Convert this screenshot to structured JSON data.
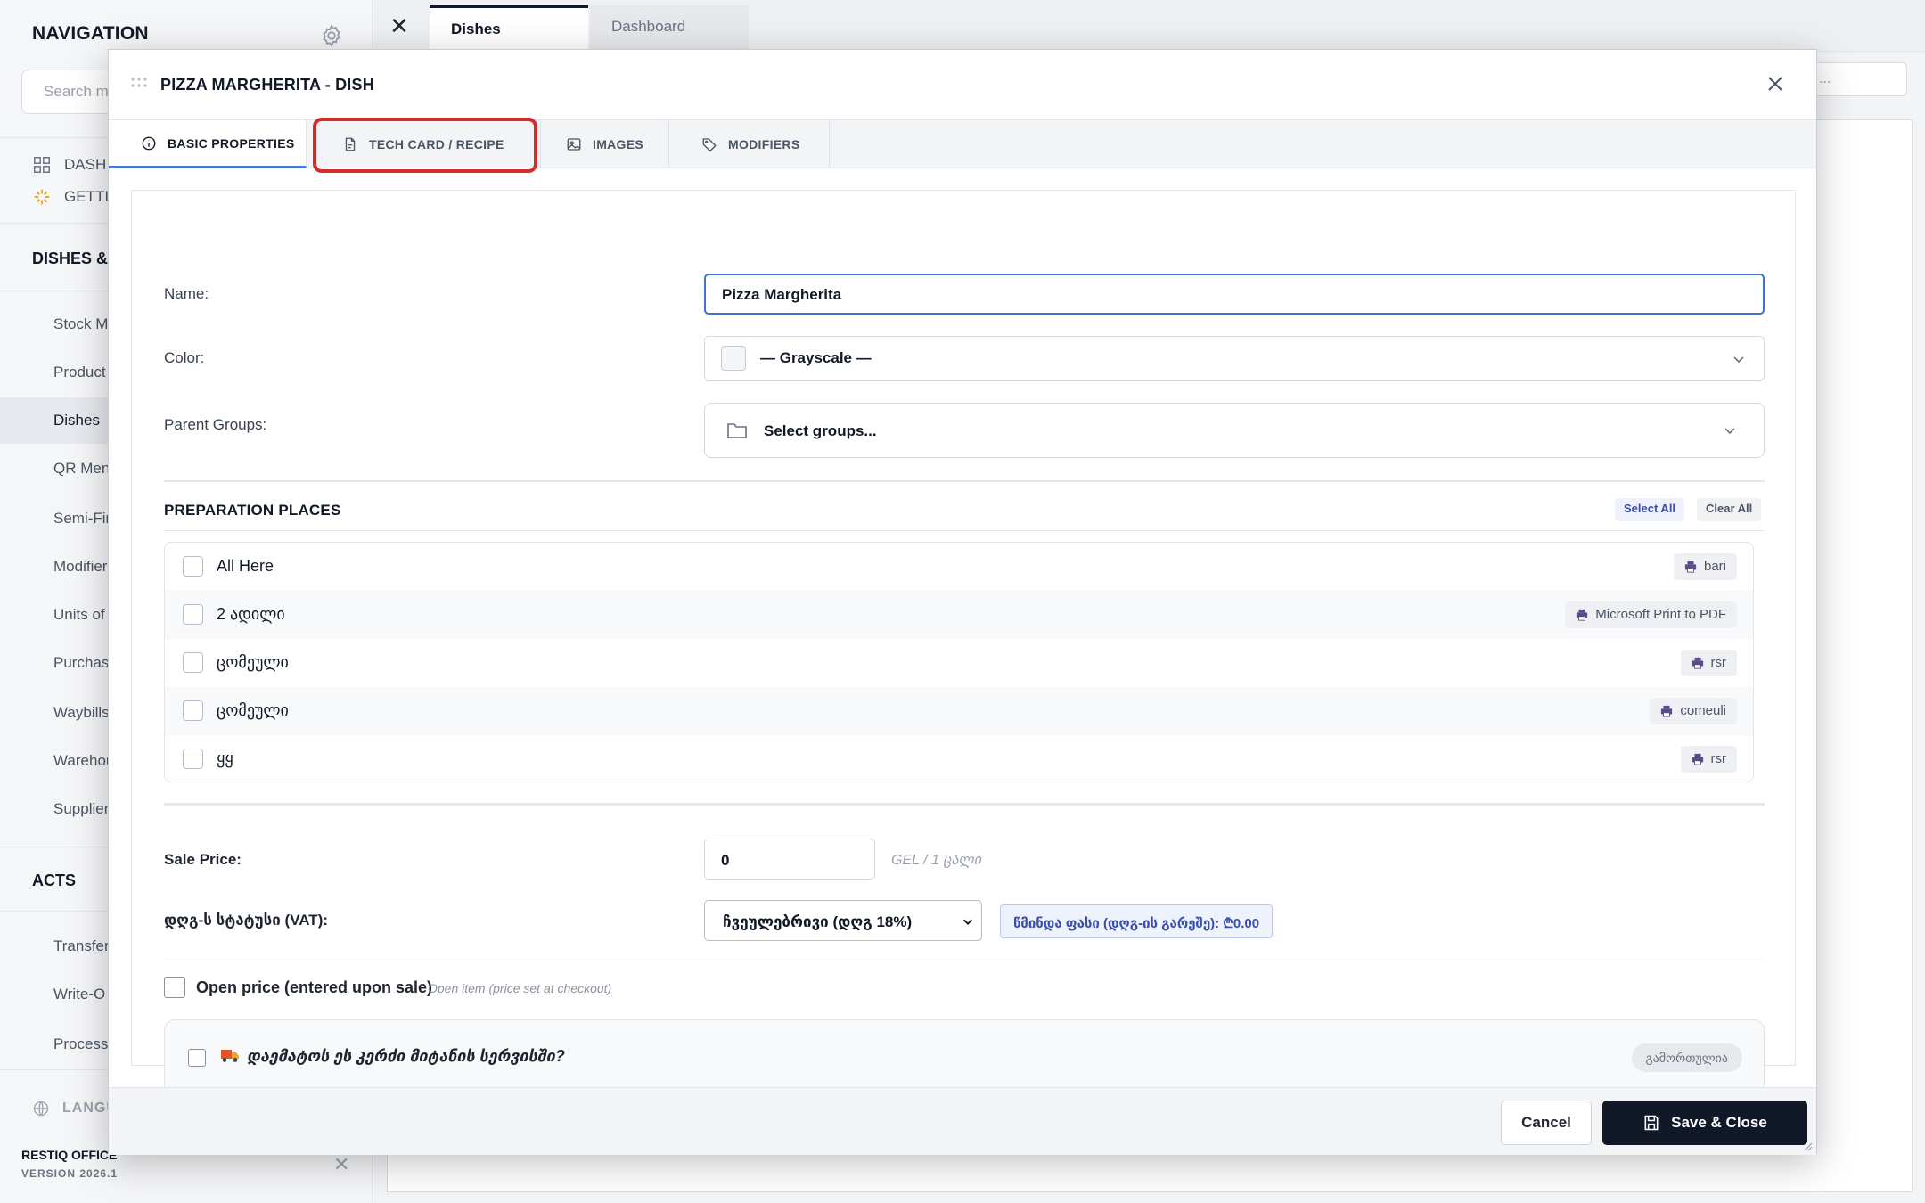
{
  "sidebar": {
    "title": "NAVIGATION",
    "search_placeholder": "Search m",
    "top_items": [
      {
        "label": "DASH",
        "icon": "grid-icon"
      },
      {
        "label": "GETTI",
        "icon": "sparkle-icon"
      }
    ],
    "sections": [
      {
        "title": "DISHES &",
        "items": [
          "Stock M",
          "Product",
          "Dishes",
          "QR Men",
          "Semi-Fir",
          "Modifier",
          "Units of",
          "Purchas",
          "Waybills",
          "Warehou",
          "Supplier"
        ]
      },
      {
        "title": "ACTS",
        "items": [
          "Transfer",
          "Write-O",
          "Processi"
        ]
      }
    ],
    "active_item": "Dishes",
    "language_label": "LANGU",
    "brand": "RESTIQ OFFICE",
    "version": "VERSION 2026.1"
  },
  "app_tabs": [
    {
      "label": "Dishes",
      "active": true
    },
    {
      "label": "Dashboard",
      "active": false
    }
  ],
  "background_search_placeholder": "...",
  "modal": {
    "title": "PIZZA MARGHERITA - DISH",
    "tabs": [
      {
        "label": "BASIC PROPERTIES",
        "icon": "info-icon",
        "active": true
      },
      {
        "label": "TECH CARD / RECIPE",
        "icon": "document-icon",
        "active": false
      },
      {
        "label": "IMAGES",
        "icon": "image-icon",
        "active": false
      },
      {
        "label": "MODIFIERS",
        "icon": "tag-icon",
        "active": false
      }
    ],
    "highlighted_tab": "TECH CARD / RECIPE",
    "highlight_color": "#d62b2b",
    "form": {
      "name_label": "Name:",
      "name_value": "Pizza Margherita",
      "color_label": "Color:",
      "color_value": "— Grayscale —",
      "parent_groups_label": "Parent Groups:",
      "parent_groups_placeholder": "Select groups...",
      "preparation_title": "PREPARATION PLACES",
      "select_all": "Select All",
      "clear_all": "Clear All",
      "places": [
        {
          "name": "All Here",
          "printer": "bari",
          "checked": false
        },
        {
          "name": "2 ადილი",
          "printer": "Microsoft Print to PDF",
          "checked": false
        },
        {
          "name": "ცომეული",
          "printer": "rsr",
          "checked": false
        },
        {
          "name": "ცომეული",
          "printer": "comeuli",
          "checked": false
        },
        {
          "name": "ყყ",
          "printer": "rsr",
          "checked": false
        }
      ],
      "sale_price_label": "Sale Price:",
      "sale_price_value": "0",
      "sale_price_unit": "GEL / 1 ცალი",
      "vat_label": "დღგ-ს სტატუსი (VAT):",
      "vat_value": "ჩვეულებრივი (დღგ 18%)",
      "net_price": "წმინდა ფასი (დღგ-ის გარეშე): ₾0.00",
      "open_price_label": "Open price (entered upon sale)",
      "open_price_hint": "Open item (price set at checkout)",
      "delivery_label": "დაემატოს ეს კერძი მიტანის სერვისში?",
      "delivery_status": "გამორთულია"
    },
    "footer": {
      "cancel": "Cancel",
      "save": "Save & Close"
    }
  },
  "colors": {
    "accent": "#4a78d6",
    "primary_button": "#111827",
    "focus_border": "#3d72cf"
  }
}
